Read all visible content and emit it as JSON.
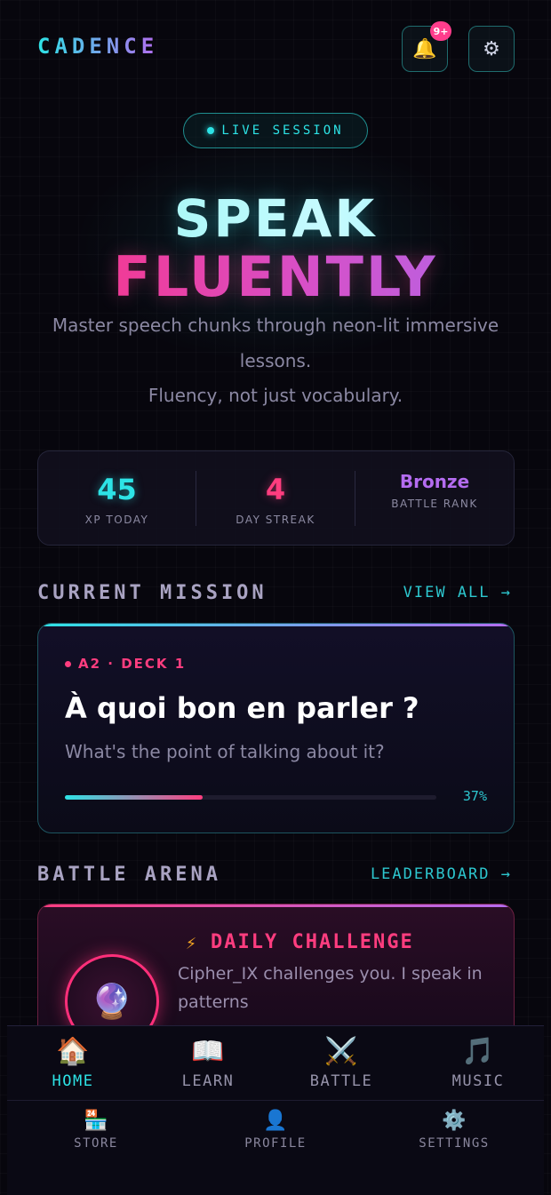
{
  "header": {
    "logo": "CADENCE",
    "notification_badge": "9+",
    "bell_icon": "bell-icon",
    "gear_icon": "gear-icon"
  },
  "session": {
    "label": "LIVE SESSION"
  },
  "hero": {
    "line1": "SPEAK",
    "line2": "FLUENTLY",
    "subtitle1": "Master speech chunks through neon-lit immersive lessons.",
    "subtitle2": "Fluency, not just vocabulary."
  },
  "stats": [
    {
      "value": "45",
      "label": "XP TODAY"
    },
    {
      "value": "4",
      "label": "DAY STREAK"
    },
    {
      "value": "Bronze",
      "label": "BATTLE RANK"
    }
  ],
  "mission_section": {
    "title": "CURRENT MISSION",
    "link": "VIEW ALL →"
  },
  "mission": {
    "tag": "A2 · DECK 1",
    "title": "À quoi bon en parler ?",
    "subtitle": "What's the point of talking about it?",
    "progress": 37,
    "progress_label": "37%"
  },
  "battle_section": {
    "title": "BATTLE ARENA",
    "link": "LEADERBOARD →"
  },
  "battle": {
    "title": "DAILY CHALLENGE",
    "description": "Cipher_IX challenges you. I speak in patterns",
    "icon": "crystal-ball-icon"
  },
  "nav": {
    "primary": [
      {
        "label": "HOME",
        "icon": "🏠",
        "active": true
      },
      {
        "label": "LEARN",
        "icon": "📖",
        "active": false
      },
      {
        "label": "BATTLE",
        "icon": "⚔️",
        "active": false
      },
      {
        "label": "MUSIC",
        "icon": "🎵",
        "active": false
      }
    ],
    "secondary": [
      {
        "label": "STORE",
        "icon": "🏪"
      },
      {
        "label": "PROFILE",
        "icon": "👤"
      },
      {
        "label": "SETTINGS",
        "icon": "⚙️"
      }
    ]
  },
  "colors": {
    "cyan": "#2de3e6",
    "pink": "#ff3d7f",
    "purple": "#b46cf0",
    "background": "#07060d"
  }
}
